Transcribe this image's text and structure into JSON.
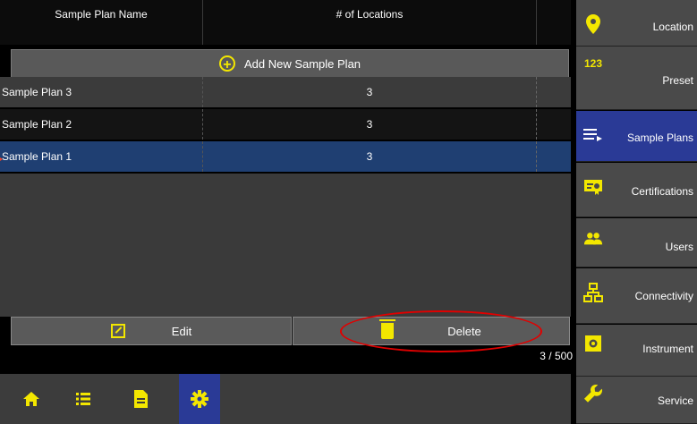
{
  "table": {
    "headers": [
      "Sample Plan Name",
      "# of Locations"
    ],
    "add_label": "Add New Sample Plan",
    "rows": [
      {
        "name": "Sample Plan 3",
        "locations": "3"
      },
      {
        "name": "Sample Plan 2",
        "locations": "3"
      },
      {
        "name": "Sample Plan 1",
        "locations": "3",
        "selected": true
      }
    ],
    "count": "3 / 500"
  },
  "actions": {
    "edit_label": "Edit",
    "delete_label": "Delete"
  },
  "sidebar": {
    "items": [
      {
        "label": "Location",
        "icon": "location-pin-icon"
      },
      {
        "label": "Preset",
        "icon": "123-icon",
        "glyph": "123"
      },
      {
        "label": "Sample Plans",
        "icon": "list-icon",
        "selected": true
      },
      {
        "label": "Certifications",
        "icon": "certificate-icon"
      },
      {
        "label": "Users",
        "icon": "users-icon"
      },
      {
        "label": "Connectivity",
        "icon": "network-icon"
      },
      {
        "label": "Instrument",
        "icon": "instrument-icon"
      },
      {
        "label": "Service",
        "icon": "wrench-icon"
      }
    ]
  },
  "bottom_nav": {
    "items": [
      {
        "icon": "home-icon"
      },
      {
        "icon": "list-icon"
      },
      {
        "icon": "document-icon"
      },
      {
        "icon": "gear-icon",
        "selected": true
      }
    ]
  },
  "colors": {
    "accent": "#f3e700",
    "selected": "#2a3a96",
    "row_selected": "#1f3f72",
    "annotation": "#e00000"
  }
}
